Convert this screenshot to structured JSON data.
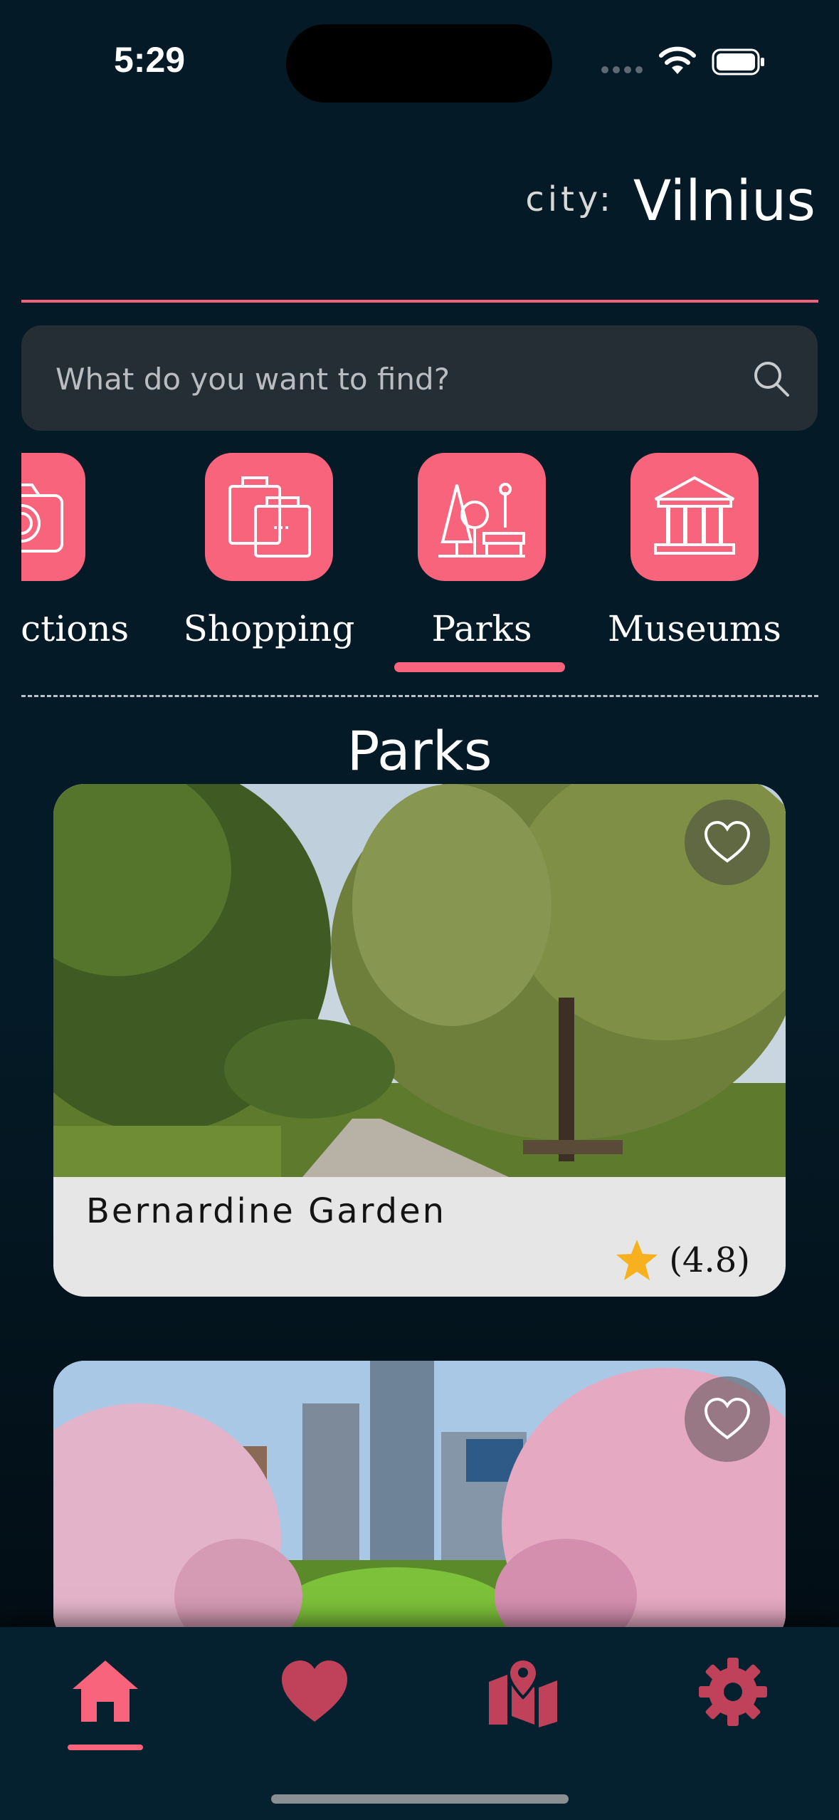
{
  "status_bar": {
    "time": "5:29"
  },
  "header": {
    "city_label": "city:",
    "city_name": "Vilnius"
  },
  "search": {
    "placeholder": "What do you want to find?"
  },
  "categories": [
    {
      "label": "Attractions",
      "icon": "camera-icon",
      "selected": false
    },
    {
      "label": "Shopping",
      "icon": "shopping-bags-icon",
      "selected": false
    },
    {
      "label": "Parks",
      "icon": "park-icon",
      "selected": true
    },
    {
      "label": "Museums",
      "icon": "museum-icon",
      "selected": false
    }
  ],
  "section": {
    "title": "Parks"
  },
  "places": [
    {
      "name": "Bernardine Garden",
      "rating": "(4.8)",
      "favorited": false
    },
    {
      "name": "",
      "rating": "",
      "favorited": false
    }
  ],
  "nav": {
    "items": [
      {
        "icon": "home-icon",
        "active": true
      },
      {
        "icon": "heart-icon",
        "active": false
      },
      {
        "icon": "map-icon",
        "active": false
      },
      {
        "icon": "gear-icon",
        "active": false
      }
    ]
  },
  "colors": {
    "accent": "#f8647c",
    "background": "#041a26",
    "nav_inactive": "#c0425a",
    "card_bg": "#e6e6e6"
  }
}
